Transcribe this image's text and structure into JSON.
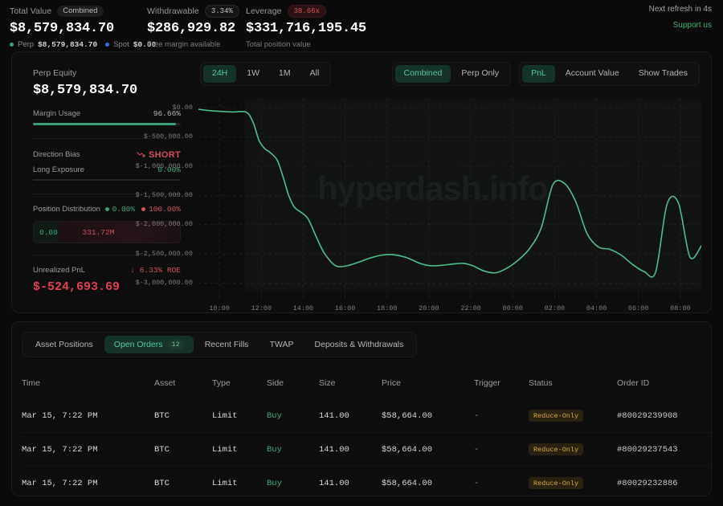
{
  "header": {
    "total": {
      "label": "Total Value",
      "badge": "Combined",
      "value": "$8,579,834.70",
      "perp_label": "Perp",
      "perp_value": "$8,579,834.70",
      "spot_label": "Spot",
      "spot_value": "$0.00"
    },
    "withdrawable": {
      "label": "Withdrawable",
      "badge": "3.34%",
      "value": "$286,929.82",
      "note": "Free margin available"
    },
    "leverage": {
      "label": "Leverage",
      "badge": "38.66x",
      "value": "$331,716,195.45",
      "note": "Total position value"
    },
    "refresh": "Next refresh in 4s",
    "support": "Support us"
  },
  "metrics": {
    "perp_equity_label": "Perp Equity",
    "perp_equity_value": "$8,579,834.70",
    "margin_usage_label": "Margin Usage",
    "margin_usage_value": "96.66%",
    "margin_usage_pct": 96.66,
    "direction_bias_label": "Direction Bias",
    "direction_bias_value": "SHORT",
    "long_exposure_label": "Long Exposure",
    "long_exposure_value": "0.00%",
    "long_exposure_pct": 0,
    "position_distribution_label": "Position Distribution",
    "dist_long_pct": "0.00%",
    "dist_short_pct": "100.00%",
    "dist_long_value": "0.00",
    "dist_short_value": "331.72M",
    "unrealized_pnl_label": "Unrealized PnL",
    "roe": "6.33% ROE",
    "roe_arrow": "↓",
    "unrealized_pnl_value": "$-524,693.69"
  },
  "chart_controls": {
    "ranges": [
      {
        "label": "24H",
        "active": true
      },
      {
        "label": "1W",
        "active": false
      },
      {
        "label": "1M",
        "active": false
      },
      {
        "label": "All",
        "active": false
      }
    ],
    "modes": [
      {
        "label": "Combined",
        "active": true
      },
      {
        "label": "Perp Only",
        "active": false
      }
    ],
    "series_toggles": [
      {
        "label": "PnL",
        "active": true
      },
      {
        "label": "Account Value",
        "active": false
      },
      {
        "label": "Show Trades",
        "active": false
      }
    ]
  },
  "chart_data": {
    "type": "line",
    "title": "",
    "watermark": "hyperdash.info",
    "xlabel": "",
    "ylabel": "",
    "line_color": "#4fbf8b",
    "grid": true,
    "ylim": [
      -3250000,
      150000
    ],
    "yticks": [
      0,
      -500000,
      -1000000,
      -1500000,
      -2000000,
      -2500000,
      -3000000
    ],
    "ytick_labels": [
      "$0.00",
      "$-500,000.00",
      "$-1,000,000.00",
      "$-1,500,000.00",
      "$-2,000,000.00",
      "$-2,500,000.00",
      "$-3,000,000.00"
    ],
    "xtick_labels": [
      "10:00",
      "12:00",
      "14:00",
      "16:00",
      "18:00",
      "20:00",
      "22:00",
      "00:00",
      "02:00",
      "04:00",
      "06:00",
      "08:00"
    ],
    "series": [
      {
        "name": "PnL",
        "x": [
          0,
          1.5,
          3.0,
          4.2,
          4.8,
          5.3,
          5.8,
          6.3,
          6.9,
          7.4,
          7.9,
          8.4,
          9.0,
          9.6,
          10.3,
          11.0,
          12.0,
          13.0,
          14.0,
          15.0,
          16.0,
          17.0,
          18.2,
          19.4,
          20.4,
          21.4,
          22.3,
          23.2,
          24.0,
          25.0,
          26.0,
          27.0,
          28.0,
          29.0,
          30.0,
          31.0,
          32.0,
          33.0,
          34.0,
          35.0,
          36.0,
          37.0,
          38.0,
          39.0,
          40.0,
          41.0,
          42.0,
          43.0,
          44.0
        ],
        "y": [
          -30000,
          -60000,
          -75000,
          -80000,
          -260000,
          -560000,
          -700000,
          -770000,
          -900000,
          -1180000,
          -1500000,
          -1700000,
          -1790000,
          -1900000,
          -2200000,
          -2480000,
          -2700000,
          -2700000,
          -2640000,
          -2570000,
          -2520000,
          -2510000,
          -2560000,
          -2660000,
          -2700000,
          -2690000,
          -2670000,
          -2660000,
          -2700000,
          -2790000,
          -2820000,
          -2740000,
          -2600000,
          -2400000,
          -2050000,
          -1320000,
          -1290000,
          -1600000,
          -2150000,
          -2380000,
          -2420000,
          -2520000,
          -2680000,
          -2800000,
          -2810000,
          -1650000,
          -1630000,
          -2550000,
          -2360000,
          -2230000
        ]
      }
    ]
  },
  "bottom": {
    "tabs": [
      {
        "label": "Asset Positions",
        "active": false,
        "count": null
      },
      {
        "label": "Open Orders",
        "active": true,
        "count": "12"
      },
      {
        "label": "Recent Fills",
        "active": false,
        "count": null
      },
      {
        "label": "TWAP",
        "active": false,
        "count": null
      },
      {
        "label": "Deposits & Withdrawals",
        "active": false,
        "count": null
      }
    ],
    "columns": [
      "Time",
      "Asset",
      "Type",
      "Side",
      "Size",
      "Price",
      "Trigger",
      "Status",
      "Order ID"
    ],
    "rows": [
      {
        "time": "Mar 15, 7:22 PM",
        "asset": "BTC",
        "type": "Limit",
        "side": "Buy",
        "size": "141.00",
        "price": "$58,664.00",
        "trigger": "-",
        "status": "Reduce-Only",
        "order_id": "#80029239908"
      },
      {
        "time": "Mar 15, 7:22 PM",
        "asset": "BTC",
        "type": "Limit",
        "side": "Buy",
        "size": "141.00",
        "price": "$58,664.00",
        "trigger": "-",
        "status": "Reduce-Only",
        "order_id": "#80029237543"
      },
      {
        "time": "Mar 15, 7:22 PM",
        "asset": "BTC",
        "type": "Limit",
        "side": "Buy",
        "size": "141.00",
        "price": "$58,664.00",
        "trigger": "-",
        "status": "Reduce-Only",
        "order_id": "#80029232886"
      }
    ]
  }
}
